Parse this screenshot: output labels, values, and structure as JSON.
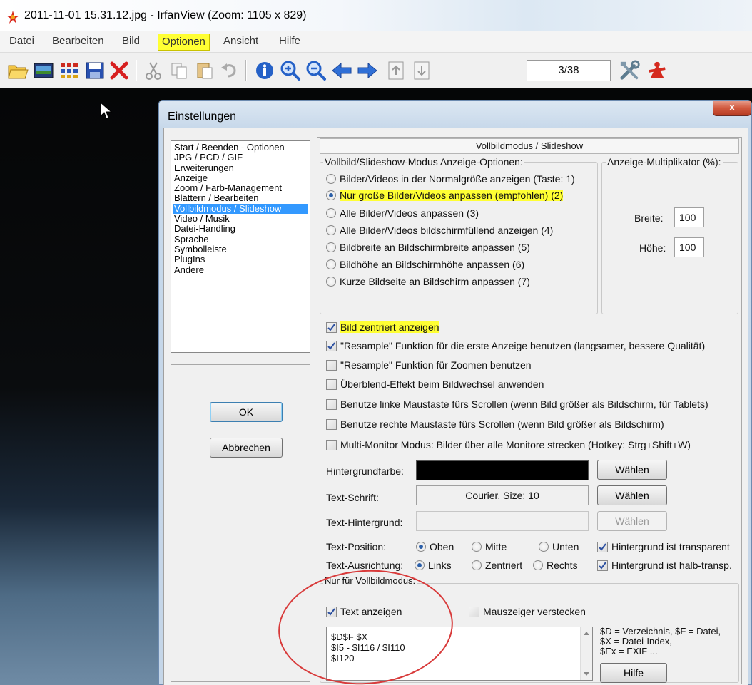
{
  "window": {
    "title": "2011-11-01 15.31.12.jpg - IrfanView (Zoom: 1105 x 829)"
  },
  "menu": {
    "items": [
      "Datei",
      "Bearbeiten",
      "Bild",
      "Optionen",
      "Ansicht",
      "Hilfe"
    ],
    "active": "Optionen"
  },
  "toolbar": {
    "page_counter": "3/38",
    "icons": [
      "open-folder-icon",
      "slideshow-icon",
      "thumbnails-icon",
      "save-icon",
      "delete-icon",
      "cut-icon",
      "copy-icon",
      "paste-icon",
      "undo-icon",
      "info-icon",
      "zoom-in-icon",
      "zoom-out-icon",
      "previous-icon",
      "next-icon",
      "first-page-icon",
      "last-page-icon",
      "settings-tools-icon",
      "exit-icon"
    ]
  },
  "dialog": {
    "title": "Einstellungen",
    "close_label": "x",
    "categories": [
      "Start / Beenden - Optionen",
      "JPG / PCD / GIF",
      "Erweiterungen",
      "Anzeige",
      "Zoom / Farb-Management",
      "Blättern / Bearbeiten",
      "Vollbildmodus / Slideshow",
      "Video / Musik",
      "Datei-Handling",
      "Sprache",
      "Symbolleiste",
      "PlugIns",
      "Andere"
    ],
    "selected_category": "Vollbildmodus / Slideshow",
    "ok_label": "OK",
    "cancel_label": "Abbrechen",
    "section_title": "Vollbildmodus / Slideshow",
    "display_options_group": "Vollbild/Slideshow-Modus Anzeige-Optionen:",
    "display_options": [
      {
        "label": "Bilder/Videos in der Normalgröße anzeigen (Taste: 1)",
        "selected": false
      },
      {
        "label": "Nur große Bilder/Videos anpassen (empfohlen) (2)",
        "selected": true
      },
      {
        "label": "Alle Bilder/Videos anpassen (3)",
        "selected": false
      },
      {
        "label": "Alle Bilder/Videos bildschirmfüllend anzeigen (4)",
        "selected": false
      },
      {
        "label": "Bildbreite an Bildschirmbreite anpassen (5)",
        "selected": false
      },
      {
        "label": "Bildhöhe an Bildschirmhöhe anpassen (6)",
        "selected": false
      },
      {
        "label": "Kurze Bildseite an Bildschirm anpassen (7)",
        "selected": false
      }
    ],
    "multiplier_group": "Anzeige-Multiplikator (%):",
    "width_label": "Breite:",
    "width_value": "100",
    "height_label": "Höhe:",
    "height_value": "100",
    "checkboxes": [
      {
        "label": "Bild zentriert anzeigen",
        "checked": true
      },
      {
        "label": "\"Resample\" Funktion für die erste Anzeige benutzen (langsamer, bessere Qualität)",
        "checked": true
      },
      {
        "label": "\"Resample\" Funktion für Zoomen benutzen",
        "checked": false
      },
      {
        "label": "Überblend-Effekt beim Bildwechsel anwenden",
        "checked": false
      },
      {
        "label": "Benutze linke Maustaste fürs Scrollen (wenn Bild größer als Bildschirm, für Tablets)",
        "checked": false
      },
      {
        "label": "Benutze rechte Maustaste fürs Scrollen (wenn Bild größer als Bildschirm)",
        "checked": false
      },
      {
        "label": "Multi-Monitor Modus: Bilder über alle Monitore strecken (Hotkey: Strg+Shift+W)",
        "checked": false
      }
    ],
    "bg_color_label": "Hintergrundfarbe:",
    "bg_color_value": "#000000",
    "choose_label": "Wählen",
    "font_label": "Text-Schrift:",
    "font_value": "Courier, Size: 10",
    "text_bg_label": "Text-Hintergrund:",
    "text_position_label": "Text-Position:",
    "text_position_options": [
      {
        "label": "Oben",
        "selected": true
      },
      {
        "label": "Mitte",
        "selected": false
      },
      {
        "label": "Unten",
        "selected": false
      }
    ],
    "bg_transparent_label": "Hintergrund ist transparent",
    "bg_transparent_checked": true,
    "text_align_label": "Text-Ausrichtung:",
    "text_align_options": [
      {
        "label": "Links",
        "selected": true
      },
      {
        "label": "Zentriert",
        "selected": false
      },
      {
        "label": "Rechts",
        "selected": false
      }
    ],
    "bg_half_transparent_label": "Hintergrund ist halb-transp.",
    "bg_half_transparent_checked": true,
    "fullscreen_only_label": "Nur für Vollbildmodus:",
    "show_text_label": "Text anzeigen",
    "show_text_checked": true,
    "hide_cursor_label": "Mauszeiger verstecken",
    "hide_cursor_checked": false,
    "text_template": [
      "$D$F $X",
      "$I5 - $I116 / $I110",
      "$I120"
    ],
    "help_text": [
      "$D = Verzeichnis, $F = Datei,",
      "$X = Datei-Index,",
      "$Ex = EXIF ..."
    ],
    "help_button": "Hilfe"
  },
  "colors": {
    "highlight": "#ffff33",
    "selection": "#3399ff",
    "annotation_circle": "#d83a3a"
  }
}
